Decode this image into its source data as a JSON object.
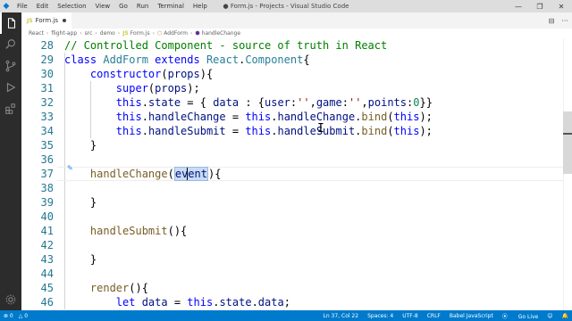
{
  "window": {
    "title": "● Form.js - Projects - Visual Studio Code",
    "menu": [
      "File",
      "Edit",
      "Selection",
      "View",
      "Go",
      "Run",
      "Terminal",
      "Help"
    ],
    "controls": {
      "minimize": "—",
      "restore": "❐",
      "close": "✕"
    }
  },
  "activity_bar": {
    "items": [
      "files-icon",
      "search-icon",
      "source-control-icon",
      "run-debug-icon",
      "extensions-icon"
    ],
    "bottom": [
      "settings-gear-icon"
    ]
  },
  "tab": {
    "icon_text": "JS",
    "label": "Form.js",
    "modified": true
  },
  "editor_actions": {
    "split": "⊟",
    "more": "···"
  },
  "breadcrumb": {
    "items": [
      "React",
      "flight-app",
      "src",
      "demo",
      "Form.js",
      "AddForm",
      "handleChange"
    ],
    "file_icon": "JS"
  },
  "editor": {
    "lines": [
      {
        "n": "28",
        "tokens": [
          [
            "c",
            "// Controlled Component - source of truth in React"
          ]
        ]
      },
      {
        "n": "29",
        "tokens": [
          [
            "k",
            "class "
          ],
          [
            "t",
            "AddForm "
          ],
          [
            "k",
            "extends "
          ],
          [
            "t",
            "React"
          ],
          [
            "p",
            "."
          ],
          [
            "t",
            "Component"
          ],
          [
            "p",
            "{"
          ]
        ]
      },
      {
        "n": "30",
        "tokens": [
          [
            "p",
            "    "
          ],
          [
            "k",
            "constructor"
          ],
          [
            "p",
            "("
          ],
          [
            "v",
            "props"
          ],
          [
            "p",
            "){"
          ]
        ]
      },
      {
        "n": "31",
        "tokens": [
          [
            "p",
            "        "
          ],
          [
            "k",
            "super"
          ],
          [
            "p",
            "("
          ],
          [
            "v",
            "props"
          ],
          [
            "p",
            ");"
          ]
        ]
      },
      {
        "n": "32",
        "tokens": [
          [
            "p",
            "        "
          ],
          [
            "k",
            "this"
          ],
          [
            "p",
            "."
          ],
          [
            "v",
            "state"
          ],
          [
            "p",
            " = { "
          ],
          [
            "v",
            "data"
          ],
          [
            "p",
            " : {"
          ],
          [
            "v",
            "user"
          ],
          [
            "p",
            ":"
          ],
          [
            "s",
            "''"
          ],
          [
            "p",
            ","
          ],
          [
            "v",
            "game"
          ],
          [
            "p",
            ":"
          ],
          [
            "s",
            "''"
          ],
          [
            "p",
            ","
          ],
          [
            "v",
            "points"
          ],
          [
            "p",
            ":"
          ],
          [
            "n",
            "0"
          ],
          [
            "p",
            "}}"
          ]
        ]
      },
      {
        "n": "33",
        "tokens": [
          [
            "p",
            "        "
          ],
          [
            "k",
            "this"
          ],
          [
            "p",
            "."
          ],
          [
            "v",
            "handleChange"
          ],
          [
            "p",
            " = "
          ],
          [
            "k",
            "this"
          ],
          [
            "p",
            "."
          ],
          [
            "v",
            "handleChange"
          ],
          [
            "p",
            "."
          ],
          [
            "f",
            "bind"
          ],
          [
            "p",
            "("
          ],
          [
            "k",
            "this"
          ],
          [
            "p",
            ");"
          ]
        ]
      },
      {
        "n": "34",
        "tokens": [
          [
            "p",
            "        "
          ],
          [
            "k",
            "this"
          ],
          [
            "p",
            "."
          ],
          [
            "v",
            "handleSubmit"
          ],
          [
            "p",
            " = "
          ],
          [
            "k",
            "this"
          ],
          [
            "p",
            "."
          ],
          [
            "v",
            "handleSubmit"
          ],
          [
            "p",
            "."
          ],
          [
            "f",
            "bind"
          ],
          [
            "p",
            "("
          ],
          [
            "k",
            "this"
          ],
          [
            "p",
            ");"
          ]
        ]
      },
      {
        "n": "35",
        "tokens": [
          [
            "p",
            "    }"
          ]
        ]
      },
      {
        "n": "36",
        "tokens": []
      },
      {
        "n": "37",
        "tokens": [
          [
            "p",
            "    "
          ],
          [
            "f",
            "handleChange"
          ],
          [
            "p",
            "("
          ],
          [
            "h",
            "event"
          ],
          [
            "p",
            "){"
          ]
        ]
      },
      {
        "n": "38",
        "tokens": []
      },
      {
        "n": "39",
        "tokens": [
          [
            "p",
            "    }"
          ]
        ]
      },
      {
        "n": "40",
        "tokens": []
      },
      {
        "n": "41",
        "tokens": [
          [
            "p",
            "    "
          ],
          [
            "f",
            "handleSubmit"
          ],
          [
            "p",
            "(){"
          ]
        ]
      },
      {
        "n": "42",
        "tokens": []
      },
      {
        "n": "43",
        "tokens": [
          [
            "p",
            "    }"
          ]
        ]
      },
      {
        "n": "44",
        "tokens": []
      },
      {
        "n": "45",
        "tokens": [
          [
            "p",
            "    "
          ],
          [
            "f",
            "render"
          ],
          [
            "p",
            "(){"
          ]
        ]
      },
      {
        "n": "46",
        "tokens": [
          [
            "p",
            "        "
          ],
          [
            "k",
            "let "
          ],
          [
            "v",
            "data"
          ],
          [
            "p",
            " = "
          ],
          [
            "k",
            "this"
          ],
          [
            "p",
            "."
          ],
          [
            "v",
            "state"
          ],
          [
            "p",
            "."
          ],
          [
            "v",
            "data"
          ],
          [
            "p",
            ";"
          ]
        ]
      }
    ]
  },
  "status_bar": {
    "errors": "⊗ 0",
    "warnings": "△ 0",
    "position": "Ln 37, Col 22",
    "spaces": "Spaces: 4",
    "encoding": "UTF-8",
    "eol": "CRLF",
    "language": "Babel JavaScript",
    "golive": "Go Live",
    "feedback": "☺",
    "notifications": "🔔"
  }
}
